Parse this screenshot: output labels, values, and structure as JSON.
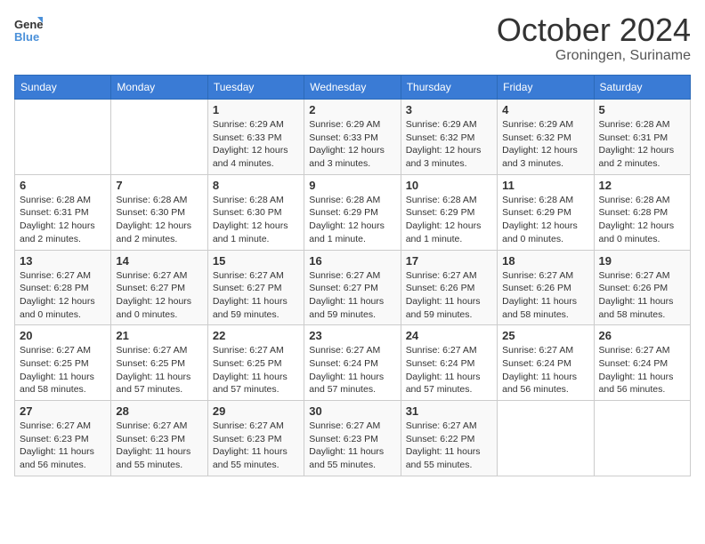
{
  "logo": {
    "line1": "General",
    "line2": "Blue"
  },
  "title": "October 2024",
  "subtitle": "Groningen, Suriname",
  "days_of_week": [
    "Sunday",
    "Monday",
    "Tuesday",
    "Wednesday",
    "Thursday",
    "Friday",
    "Saturday"
  ],
  "weeks": [
    [
      {
        "day": "",
        "detail": ""
      },
      {
        "day": "",
        "detail": ""
      },
      {
        "day": "1",
        "detail": "Sunrise: 6:29 AM\nSunset: 6:33 PM\nDaylight: 12 hours and 4 minutes."
      },
      {
        "day": "2",
        "detail": "Sunrise: 6:29 AM\nSunset: 6:33 PM\nDaylight: 12 hours and 3 minutes."
      },
      {
        "day": "3",
        "detail": "Sunrise: 6:29 AM\nSunset: 6:32 PM\nDaylight: 12 hours and 3 minutes."
      },
      {
        "day": "4",
        "detail": "Sunrise: 6:29 AM\nSunset: 6:32 PM\nDaylight: 12 hours and 3 minutes."
      },
      {
        "day": "5",
        "detail": "Sunrise: 6:28 AM\nSunset: 6:31 PM\nDaylight: 12 hours and 2 minutes."
      }
    ],
    [
      {
        "day": "6",
        "detail": "Sunrise: 6:28 AM\nSunset: 6:31 PM\nDaylight: 12 hours and 2 minutes."
      },
      {
        "day": "7",
        "detail": "Sunrise: 6:28 AM\nSunset: 6:30 PM\nDaylight: 12 hours and 2 minutes."
      },
      {
        "day": "8",
        "detail": "Sunrise: 6:28 AM\nSunset: 6:30 PM\nDaylight: 12 hours and 1 minute."
      },
      {
        "day": "9",
        "detail": "Sunrise: 6:28 AM\nSunset: 6:29 PM\nDaylight: 12 hours and 1 minute."
      },
      {
        "day": "10",
        "detail": "Sunrise: 6:28 AM\nSunset: 6:29 PM\nDaylight: 12 hours and 1 minute."
      },
      {
        "day": "11",
        "detail": "Sunrise: 6:28 AM\nSunset: 6:29 PM\nDaylight: 12 hours and 0 minutes."
      },
      {
        "day": "12",
        "detail": "Sunrise: 6:28 AM\nSunset: 6:28 PM\nDaylight: 12 hours and 0 minutes."
      }
    ],
    [
      {
        "day": "13",
        "detail": "Sunrise: 6:27 AM\nSunset: 6:28 PM\nDaylight: 12 hours and 0 minutes."
      },
      {
        "day": "14",
        "detail": "Sunrise: 6:27 AM\nSunset: 6:27 PM\nDaylight: 12 hours and 0 minutes."
      },
      {
        "day": "15",
        "detail": "Sunrise: 6:27 AM\nSunset: 6:27 PM\nDaylight: 11 hours and 59 minutes."
      },
      {
        "day": "16",
        "detail": "Sunrise: 6:27 AM\nSunset: 6:27 PM\nDaylight: 11 hours and 59 minutes."
      },
      {
        "day": "17",
        "detail": "Sunrise: 6:27 AM\nSunset: 6:26 PM\nDaylight: 11 hours and 59 minutes."
      },
      {
        "day": "18",
        "detail": "Sunrise: 6:27 AM\nSunset: 6:26 PM\nDaylight: 11 hours and 58 minutes."
      },
      {
        "day": "19",
        "detail": "Sunrise: 6:27 AM\nSunset: 6:26 PM\nDaylight: 11 hours and 58 minutes."
      }
    ],
    [
      {
        "day": "20",
        "detail": "Sunrise: 6:27 AM\nSunset: 6:25 PM\nDaylight: 11 hours and 58 minutes."
      },
      {
        "day": "21",
        "detail": "Sunrise: 6:27 AM\nSunset: 6:25 PM\nDaylight: 11 hours and 57 minutes."
      },
      {
        "day": "22",
        "detail": "Sunrise: 6:27 AM\nSunset: 6:25 PM\nDaylight: 11 hours and 57 minutes."
      },
      {
        "day": "23",
        "detail": "Sunrise: 6:27 AM\nSunset: 6:24 PM\nDaylight: 11 hours and 57 minutes."
      },
      {
        "day": "24",
        "detail": "Sunrise: 6:27 AM\nSunset: 6:24 PM\nDaylight: 11 hours and 57 minutes."
      },
      {
        "day": "25",
        "detail": "Sunrise: 6:27 AM\nSunset: 6:24 PM\nDaylight: 11 hours and 56 minutes."
      },
      {
        "day": "26",
        "detail": "Sunrise: 6:27 AM\nSunset: 6:24 PM\nDaylight: 11 hours and 56 minutes."
      }
    ],
    [
      {
        "day": "27",
        "detail": "Sunrise: 6:27 AM\nSunset: 6:23 PM\nDaylight: 11 hours and 56 minutes."
      },
      {
        "day": "28",
        "detail": "Sunrise: 6:27 AM\nSunset: 6:23 PM\nDaylight: 11 hours and 55 minutes."
      },
      {
        "day": "29",
        "detail": "Sunrise: 6:27 AM\nSunset: 6:23 PM\nDaylight: 11 hours and 55 minutes."
      },
      {
        "day": "30",
        "detail": "Sunrise: 6:27 AM\nSunset: 6:23 PM\nDaylight: 11 hours and 55 minutes."
      },
      {
        "day": "31",
        "detail": "Sunrise: 6:27 AM\nSunset: 6:22 PM\nDaylight: 11 hours and 55 minutes."
      },
      {
        "day": "",
        "detail": ""
      },
      {
        "day": "",
        "detail": ""
      }
    ]
  ]
}
